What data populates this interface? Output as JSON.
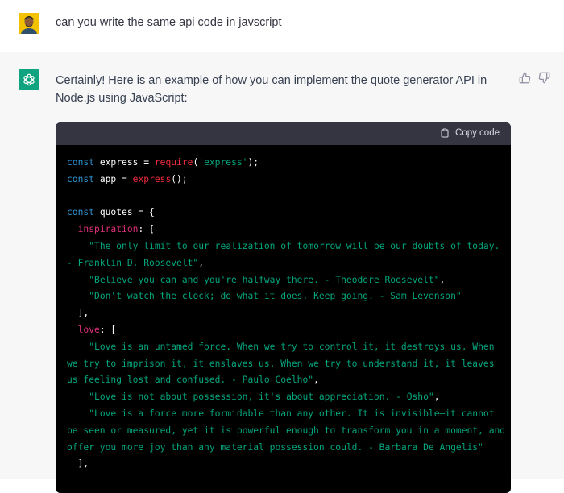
{
  "user_message": {
    "text": "can you write the same api code in javscript"
  },
  "assistant_message": {
    "intro": "Certainly! Here is an example of how you can implement the quote generator API in Node.js using JavaScript:",
    "copy_label": "Copy code",
    "code": {
      "kw_const": "const",
      "express_var": "express",
      "eq": " = ",
      "require_fn": "require",
      "open_paren": "(",
      "express_str": "'express'",
      "close_semicolon": ");",
      "app_var": "app",
      "express_fn": "express",
      "call_end": "();",
      "quotes_var": "quotes",
      "open_brace": "{",
      "inspiration_key": "inspiration",
      "colon_bracket": ": [",
      "q1_line1": "\"The only limit to our realization of tomorrow will be our doubts of today.",
      "q1_line2": "- Franklin D. Roosevelt\"",
      "q2": "\"Believe you can and you're halfway there. - Theodore Roosevelt\"",
      "q3": "\"Don't watch the clock; do what it does. Keep going. - Sam Levenson\"",
      "comma": ",",
      "close_bracket_comma": "],",
      "love_key": "love",
      "l1_line1": "\"Love is an untamed force. When we try to control it, it destroys us. When",
      "l1_line2": "we try to imprison it, it enslaves us. When we try to understand it, it leaves",
      "l1_line3": "us feeling lost and confused. - Paulo Coelho\"",
      "l2": "\"Love is not about possession, it's about appreciation. - Osho\"",
      "l3_line1": "\"Love is a force more formidable than any other. It is invisible—it cannot",
      "l3_line2": "be seen or measured, yet it is powerful enough to transform you in a moment, and",
      "l3_line3": "offer you more joy than any material possession could. - Barbara De Angelis\""
    }
  },
  "colors": {
    "assistant_brand": "#10a37f",
    "code_keyword": "#2e95d3",
    "code_function": "#f22c3d",
    "code_string": "#00a67d",
    "code_property": "#df3079"
  },
  "icons": [
    "user-avatar",
    "chatgpt-logo-icon",
    "thumbs-up-icon",
    "thumbs-down-icon",
    "clipboard-icon"
  ]
}
